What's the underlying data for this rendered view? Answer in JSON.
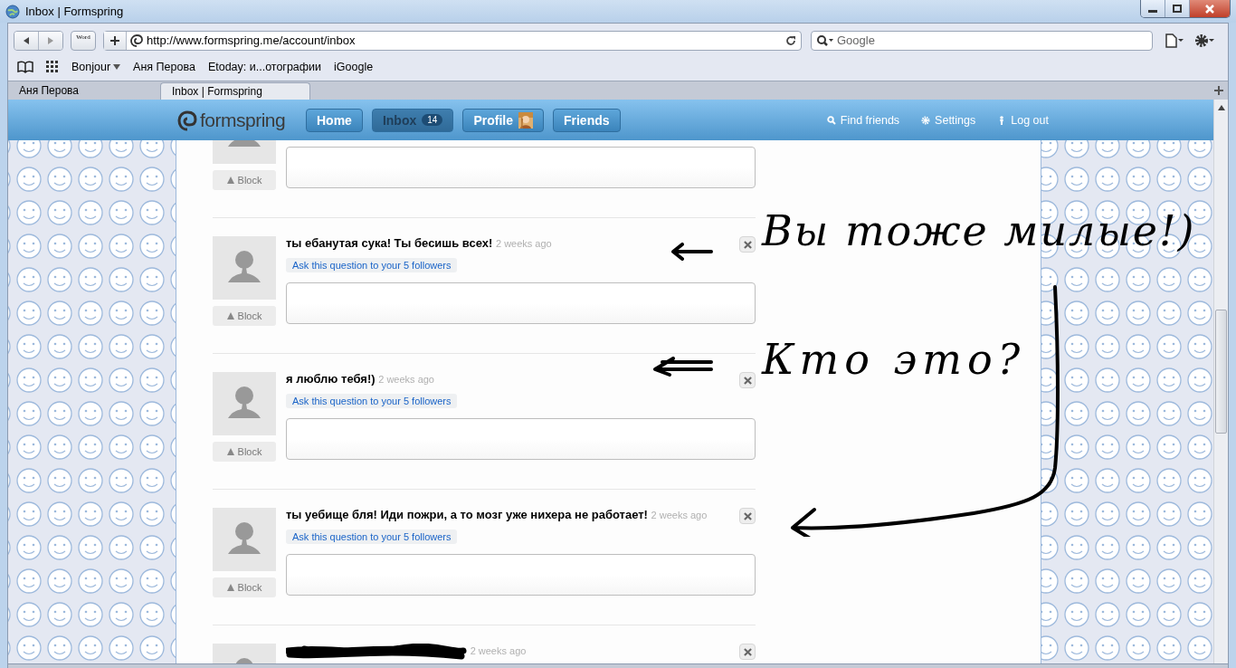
{
  "window": {
    "title": "Inbox | Formspring"
  },
  "toolbar": {
    "word_button": "Word",
    "address": "http://www.formspring.me/account/inbox",
    "search": {
      "placeholder": "Google"
    }
  },
  "bookmarks": [
    {
      "label": "Bonjour",
      "kind": "menu"
    },
    {
      "label": "Аня Перова",
      "kind": "link"
    },
    {
      "label": "Etoday: и...отографии",
      "kind": "link"
    },
    {
      "label": "iGoogle",
      "kind": "link"
    }
  ],
  "tabs": [
    {
      "label": "Аня Перова",
      "selected": false
    },
    {
      "label": "Inbox | Formspring",
      "selected": true
    }
  ],
  "site": {
    "logo": "formspring",
    "nav": [
      {
        "label": "Home",
        "selected": false,
        "kind": "plain"
      },
      {
        "label": "Inbox",
        "selected": true,
        "kind": "badge",
        "badge": "14"
      },
      {
        "label": "Profile",
        "selected": false
      },
      {
        "label": "Friends",
        "selected": false,
        "kind": "plain"
      }
    ],
    "links": [
      {
        "label": "Find friends",
        "kind": "search"
      },
      {
        "label": "Settings",
        "kind": "gear"
      },
      {
        "label": "Log out",
        "kind": "person"
      }
    ]
  },
  "questions": [
    {
      "kind": "cut",
      "block": "Block"
    },
    {
      "kind": "question",
      "question": "ты ебанутая сука! Ты бесишь всех!",
      "time": "2 weeks ago",
      "ask": "Ask this question to your 5 followers",
      "block": "Block"
    },
    {
      "kind": "question",
      "question": "я люблю тебя!)",
      "time": "2 weeks ago",
      "ask": "Ask this question to your 5 followers",
      "block": "Block"
    },
    {
      "kind": "question",
      "question": "ты уебище бля! Иди пожри, а то мозг уже нихера не работает!",
      "time": "2 weeks ago",
      "ask": "Ask this question to your 5 followers",
      "block": "Block"
    },
    {
      "kind": "redacted",
      "time": "2 weeks ago"
    }
  ],
  "annotations": [
    {
      "text": "Вы тоже милые!)"
    },
    {
      "text": "Кто это?"
    }
  ]
}
